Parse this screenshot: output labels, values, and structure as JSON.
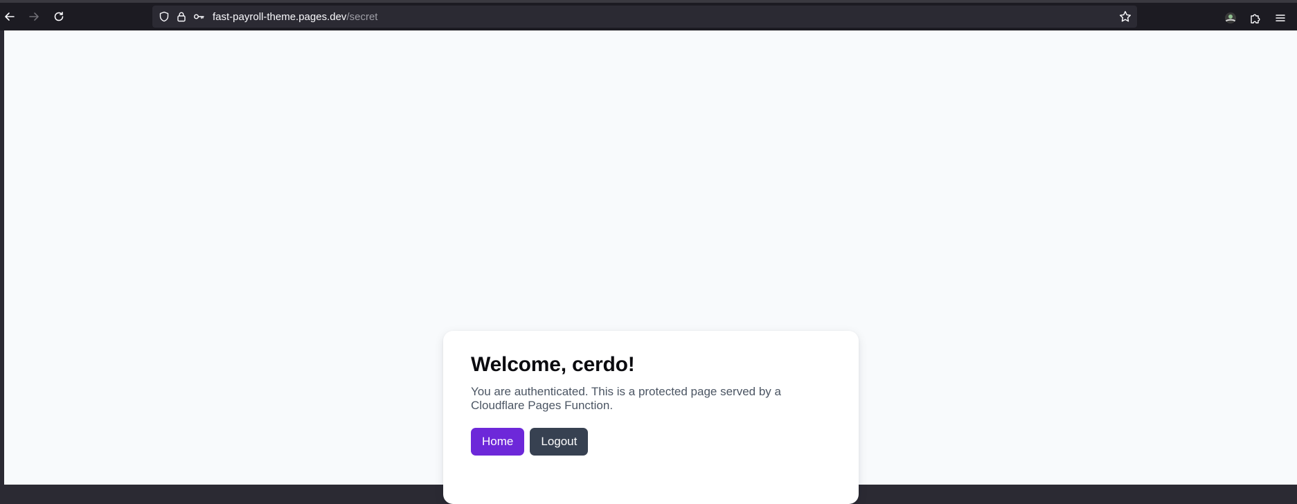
{
  "browser": {
    "url_domain": "fast-payroll-theme.pages.dev",
    "url_path": "/secret",
    "colors": {
      "toolbar": "#1c1b22",
      "urlbar": "#2b2a33",
      "icon": "#fbfbfe",
      "icon_disabled": "#6f6e75"
    }
  },
  "page": {
    "title": "Welcome, cerdo!",
    "description": "You are authenticated. This is a protected page served by a Cloudflare Pages Function.",
    "buttons": {
      "home_label": "Home",
      "logout_label": "Logout"
    },
    "colors": {
      "home": "#6d28d9",
      "logout": "#374151",
      "background": "#f8fafc"
    }
  }
}
